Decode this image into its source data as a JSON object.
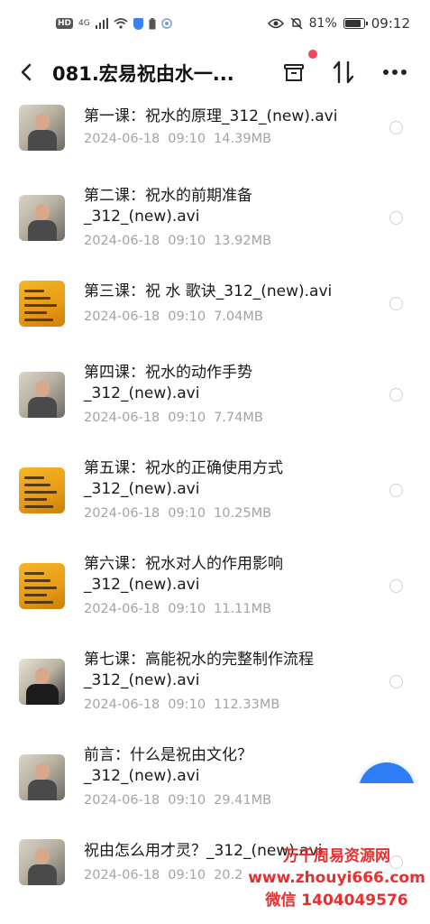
{
  "status_bar": {
    "left_badge": "HD",
    "network": "4G",
    "battery_percent": "81%",
    "time": "09:12"
  },
  "header": {
    "title": "081.宏易祝由水一..."
  },
  "files": [
    {
      "name": "第一课：祝水的原理_312_(new).avi",
      "date": "2024-06-18",
      "time": "09:10",
      "size": "14.39MB",
      "thumb": "person"
    },
    {
      "name": "第二课：祝水的前期准备_312_(new).avi",
      "date": "2024-06-18",
      "time": "09:10",
      "size": "13.92MB",
      "thumb": "person"
    },
    {
      "name": "第三课：祝 水 歌诀_312_(new).avi",
      "date": "2024-06-18",
      "time": "09:10",
      "size": "7.04MB",
      "thumb": "yellow"
    },
    {
      "name": "第四课：祝水的动作手势_312_(new).avi",
      "date": "2024-06-18",
      "time": "09:10",
      "size": "7.74MB",
      "thumb": "person"
    },
    {
      "name": "第五课：祝水的正确使用方式_312_(new).avi",
      "date": "2024-06-18",
      "time": "09:10",
      "size": "10.25MB",
      "thumb": "yellow"
    },
    {
      "name": "第六课：祝水对人的作用影响_312_(new).avi",
      "date": "2024-06-18",
      "time": "09:10",
      "size": "11.11MB",
      "thumb": "yellow"
    },
    {
      "name": "第七课：高能祝水的完整制作流程_312_(new).avi",
      "date": "2024-06-18",
      "time": "09:10",
      "size": "112.33MB",
      "thumb": "dark"
    },
    {
      "name": "前言：什么是祝由文化？_312_(new).avi",
      "date": "2024-06-18",
      "time": "09:10",
      "size": "29.41MB",
      "thumb": "person"
    },
    {
      "name": "祝由怎么用才灵？_312_(new).avi",
      "date": "2024-06-18",
      "time": "09:10",
      "size": "20.2",
      "thumb": "person"
    }
  ],
  "watermark": {
    "line1": "万千周易资源网",
    "line2": "www.zhouyi666.com",
    "line3": "微信 1404049576"
  },
  "colors": {
    "accent": "#2f7cf6",
    "badge": "#f0475c",
    "watermark": "#e53030"
  }
}
